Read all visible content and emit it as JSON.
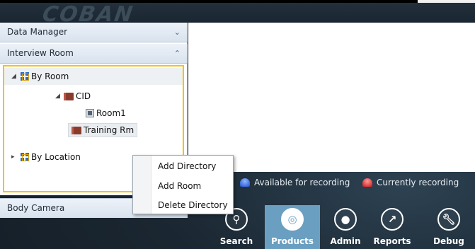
{
  "header": {
    "logo_text": "COBAN"
  },
  "left_panel": {
    "sections": {
      "data_manager": {
        "label": "Data Manager",
        "chevron": "chevron-down-icon"
      },
      "interview_room": {
        "label": "Interview Room",
        "chevron": "chevron-up-icon"
      },
      "body_camera": {
        "label": "Body Camera"
      }
    },
    "tree": {
      "by_room": "By Room",
      "cid": "CID",
      "room1": "Room1",
      "training_rm": "Training Rm",
      "by_location": "By Location"
    }
  },
  "context_menu": {
    "items": [
      "Add Directory",
      "Add Room",
      "Delete Directory"
    ]
  },
  "legend": {
    "available": "Available for recording",
    "recording": "Currently recording",
    "available_color": "#1d4fd0",
    "recording_color": "#c91414"
  },
  "nav": {
    "items": [
      {
        "label": "Search",
        "icon": "search-icon"
      },
      {
        "label": "Products",
        "icon": "products-icon",
        "active": true
      },
      {
        "label": "Admin",
        "icon": "admin-icon"
      },
      {
        "label": "Reports",
        "icon": "reports-icon"
      },
      {
        "label": "Debug",
        "icon": "wrench-icon"
      }
    ],
    "active_color": "#6a9fc1"
  }
}
